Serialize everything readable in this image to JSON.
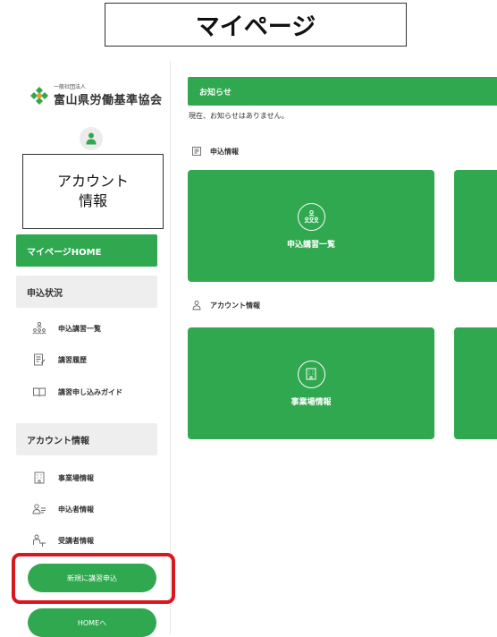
{
  "page_title": "マイページ",
  "logo": {
    "sub": "一般社団法人",
    "main": "富山県労働基準協会"
  },
  "account_box": {
    "line1": "アカウント",
    "line2": "情報"
  },
  "sidebar": {
    "home_label": "マイページHOME",
    "section_application": "申込状況",
    "items_application": [
      {
        "label": "申込講習一覧",
        "icon": "group-icon"
      },
      {
        "label": "講習履歴",
        "icon": "history-doc-icon"
      },
      {
        "label": "講習申し込みガイド",
        "icon": "book-icon"
      }
    ],
    "section_account": "アカウント情報",
    "items_account": [
      {
        "label": "事業場情報",
        "icon": "building-icon"
      },
      {
        "label": "申込者情報",
        "icon": "applicant-icon"
      },
      {
        "label": "受講者情報",
        "icon": "attendee-icon"
      }
    ],
    "new_apply_button": "新規に講習申込",
    "home_button": "HOMEへ"
  },
  "main": {
    "notice_title": "お知らせ",
    "notice_text": "現在、お知らせはありません。",
    "section_application": "申込情報",
    "card_application": "申込講習一覧",
    "section_account": "アカウント情報",
    "card_account": "事業場情報"
  },
  "colors": {
    "accent": "#2fa84f",
    "highlight": "#d8171f"
  }
}
